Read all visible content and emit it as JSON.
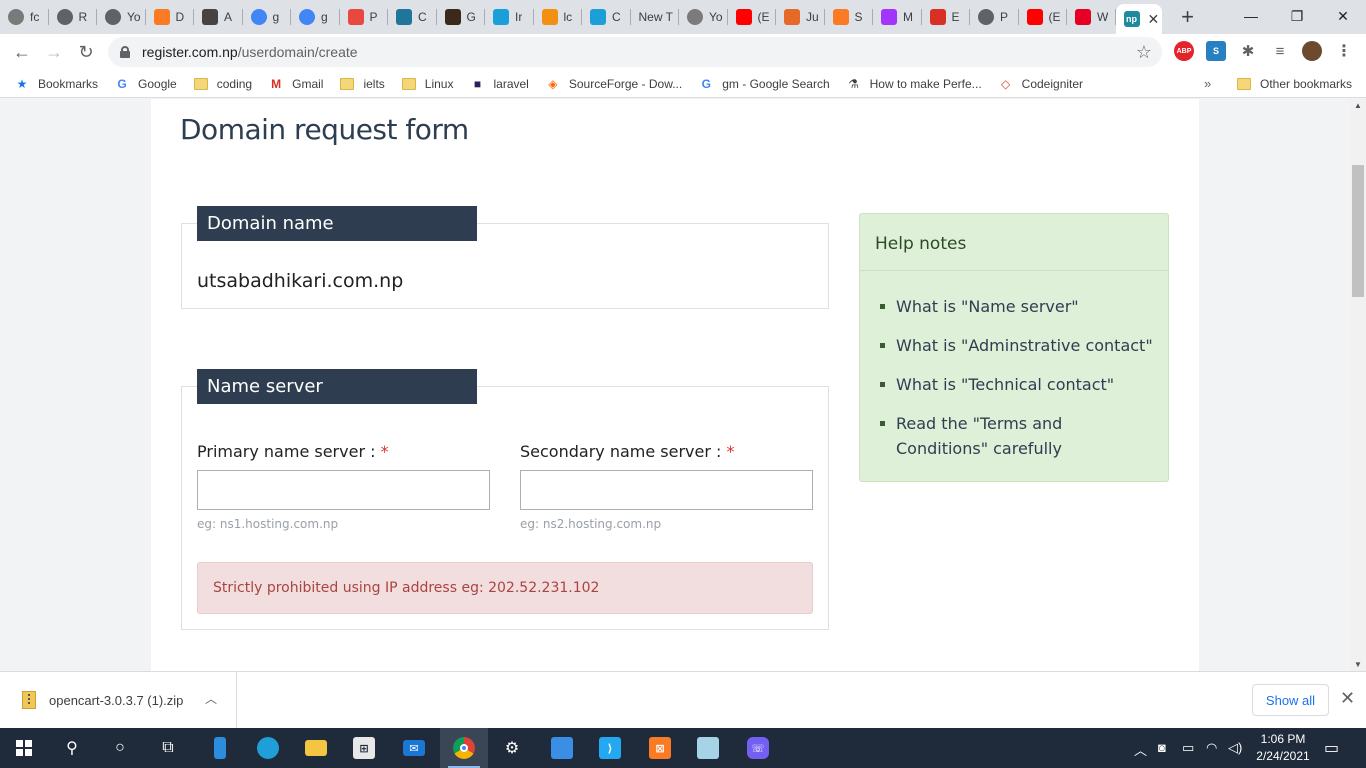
{
  "browser": {
    "tabs": [
      {
        "title": "fc",
        "icon": "code-icon",
        "color": "#7a7a7a"
      },
      {
        "title": "R",
        "icon": "globe-icon",
        "color": "#5f6368"
      },
      {
        "title": "Yo",
        "icon": "globe-icon",
        "color": "#5f6368"
      },
      {
        "title": "D",
        "icon": "xampp-icon",
        "color": "#fb7a24"
      },
      {
        "title": "A",
        "icon": "wordpress-icon",
        "color": "#464342"
      },
      {
        "title": "g",
        "icon": "google-icon",
        "color": "#4285f4"
      },
      {
        "title": "g",
        "icon": "google-icon",
        "color": "#4285f4"
      },
      {
        "title": "P",
        "icon": "pdf-icon",
        "color": "#e9483f"
      },
      {
        "title": "C",
        "icon": "wordpress-icon",
        "color": "#21759b"
      },
      {
        "title": "G",
        "icon": "dark-icon",
        "color": "#3b2a1a"
      },
      {
        "title": "Ir",
        "icon": "screen-icon",
        "color": "#1a9fd9"
      },
      {
        "title": "lc",
        "icon": "pma-icon",
        "color": "#f29111"
      },
      {
        "title": "C",
        "icon": "screen-icon",
        "color": "#1a9fd9"
      },
      {
        "title": "New T",
        "icon": "",
        "color": ""
      },
      {
        "title": "Yo",
        "icon": "cart-icon",
        "color": "#7b7b7b"
      },
      {
        "title": "(E",
        "icon": "youtube-icon",
        "color": "#ff0000"
      },
      {
        "title": "Ju",
        "icon": "pinterest-icon",
        "color": "#e66a27"
      },
      {
        "title": "S",
        "icon": "xampp-icon",
        "color": "#fb7a24"
      },
      {
        "title": "M",
        "icon": "messenger-icon",
        "color": "#a334fa"
      },
      {
        "title": "E",
        "icon": "gmail-icon",
        "color": "#d93025"
      },
      {
        "title": "P",
        "icon": "globe-icon",
        "color": "#5f6368"
      },
      {
        "title": "(E",
        "icon": "youtube-icon",
        "color": "#ff0000"
      },
      {
        "title": "W",
        "icon": "pinterest-icon",
        "color": "#e60023"
      }
    ],
    "active_tab_icon_text": "np",
    "url_domain": "register.com.np",
    "url_path": "/userdomain/create",
    "ext_abp": "ABP",
    "bookmarks": [
      {
        "label": "Bookmarks",
        "icon": "star-icon"
      },
      {
        "label": "Google",
        "icon": "google-icon"
      },
      {
        "label": "coding",
        "icon": "folder-icon"
      },
      {
        "label": "Gmail",
        "icon": "gmail-icon"
      },
      {
        "label": "ielts",
        "icon": "folder-icon"
      },
      {
        "label": "Linux",
        "icon": "folder-icon"
      },
      {
        "label": "laravel",
        "icon": "phpstorm-icon"
      },
      {
        "label": "SourceForge - Dow...",
        "icon": "sourceforge-icon"
      },
      {
        "label": "gm - Google Search",
        "icon": "google-icon"
      },
      {
        "label": "How to make Perfe...",
        "icon": "flask-icon"
      },
      {
        "label": "Codeigniter",
        "icon": "codeigniter-icon"
      }
    ],
    "bookmarks_more": "»",
    "other_bookmarks": "Other bookmarks"
  },
  "page": {
    "title": "Domain request form",
    "domain_section": {
      "heading": "Domain name",
      "value": "utsabadhikari.com.np"
    },
    "nameserver_section": {
      "heading": "Name server",
      "primary_label": "Primary name server :",
      "secondary_label": "Secondary name server :",
      "required_mark": "*",
      "primary_value": "",
      "secondary_value": "",
      "primary_hint": "eg: ns1.hosting.com.np",
      "secondary_hint": "eg: ns2.hosting.com.np",
      "warning": "Strictly prohibited using IP address eg: 202.52.231.102"
    },
    "help": {
      "title": "Help notes",
      "items": [
        "What is \"Name server\"",
        "What is \"Adminstrative contact\"",
        "What is \"Technical contact\"",
        "Read the \"Terms and Conditions\" carefully"
      ]
    }
  },
  "downloads": {
    "file_name": "opencart-3.0.3.7 (1).zip",
    "show_all": "Show all"
  },
  "taskbar": {
    "time": "1:06 PM",
    "date": "2/24/2021"
  }
}
